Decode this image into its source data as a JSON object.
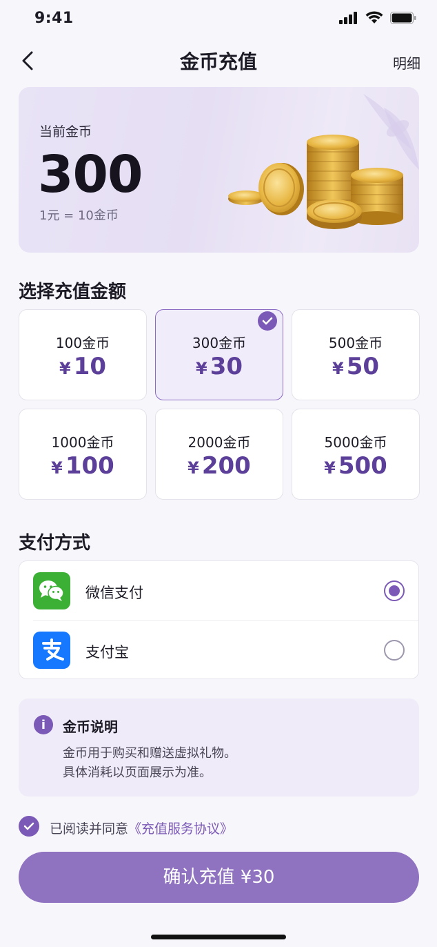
{
  "status_bar": {
    "time": "9:41"
  },
  "nav": {
    "title": "金币充值",
    "detail_label": "明细"
  },
  "balance": {
    "label": "当前金币",
    "value": "300",
    "rate": "1元 = 10金币"
  },
  "amount_section": {
    "title": "选择充值金额",
    "currency_symbol": "¥",
    "options": [
      {
        "coins": "100金币",
        "price": "10",
        "selected": false
      },
      {
        "coins": "300金币",
        "price": "30",
        "selected": true
      },
      {
        "coins": "500金币",
        "price": "50",
        "selected": false
      },
      {
        "coins": "1000金币",
        "price": "100",
        "selected": false
      },
      {
        "coins": "2000金币",
        "price": "200",
        "selected": false
      },
      {
        "coins": "5000金币",
        "price": "500",
        "selected": false
      }
    ]
  },
  "payment_section": {
    "title": "支付方式",
    "methods": [
      {
        "label": "微信支付",
        "icon": "wechat-pay-icon",
        "selected": true,
        "color": "#3cb034"
      },
      {
        "label": "支付宝",
        "icon": "alipay-icon",
        "selected": false,
        "color": "#1677ff"
      }
    ]
  },
  "notice": {
    "title": "金币说明",
    "line1": "金币用于购买和赠送虚拟礼物。",
    "line2": "具体消耗以页面展示为准。"
  },
  "agreement": {
    "prefix": "已阅读并同意",
    "link": "《充值服务协议》",
    "checked": true
  },
  "confirm": {
    "label": "确认充值 ¥30"
  },
  "colors": {
    "accent": "#7b59b6",
    "price": "#5c3f98",
    "button": "#8f72c0",
    "background": "#f7f6fb"
  }
}
